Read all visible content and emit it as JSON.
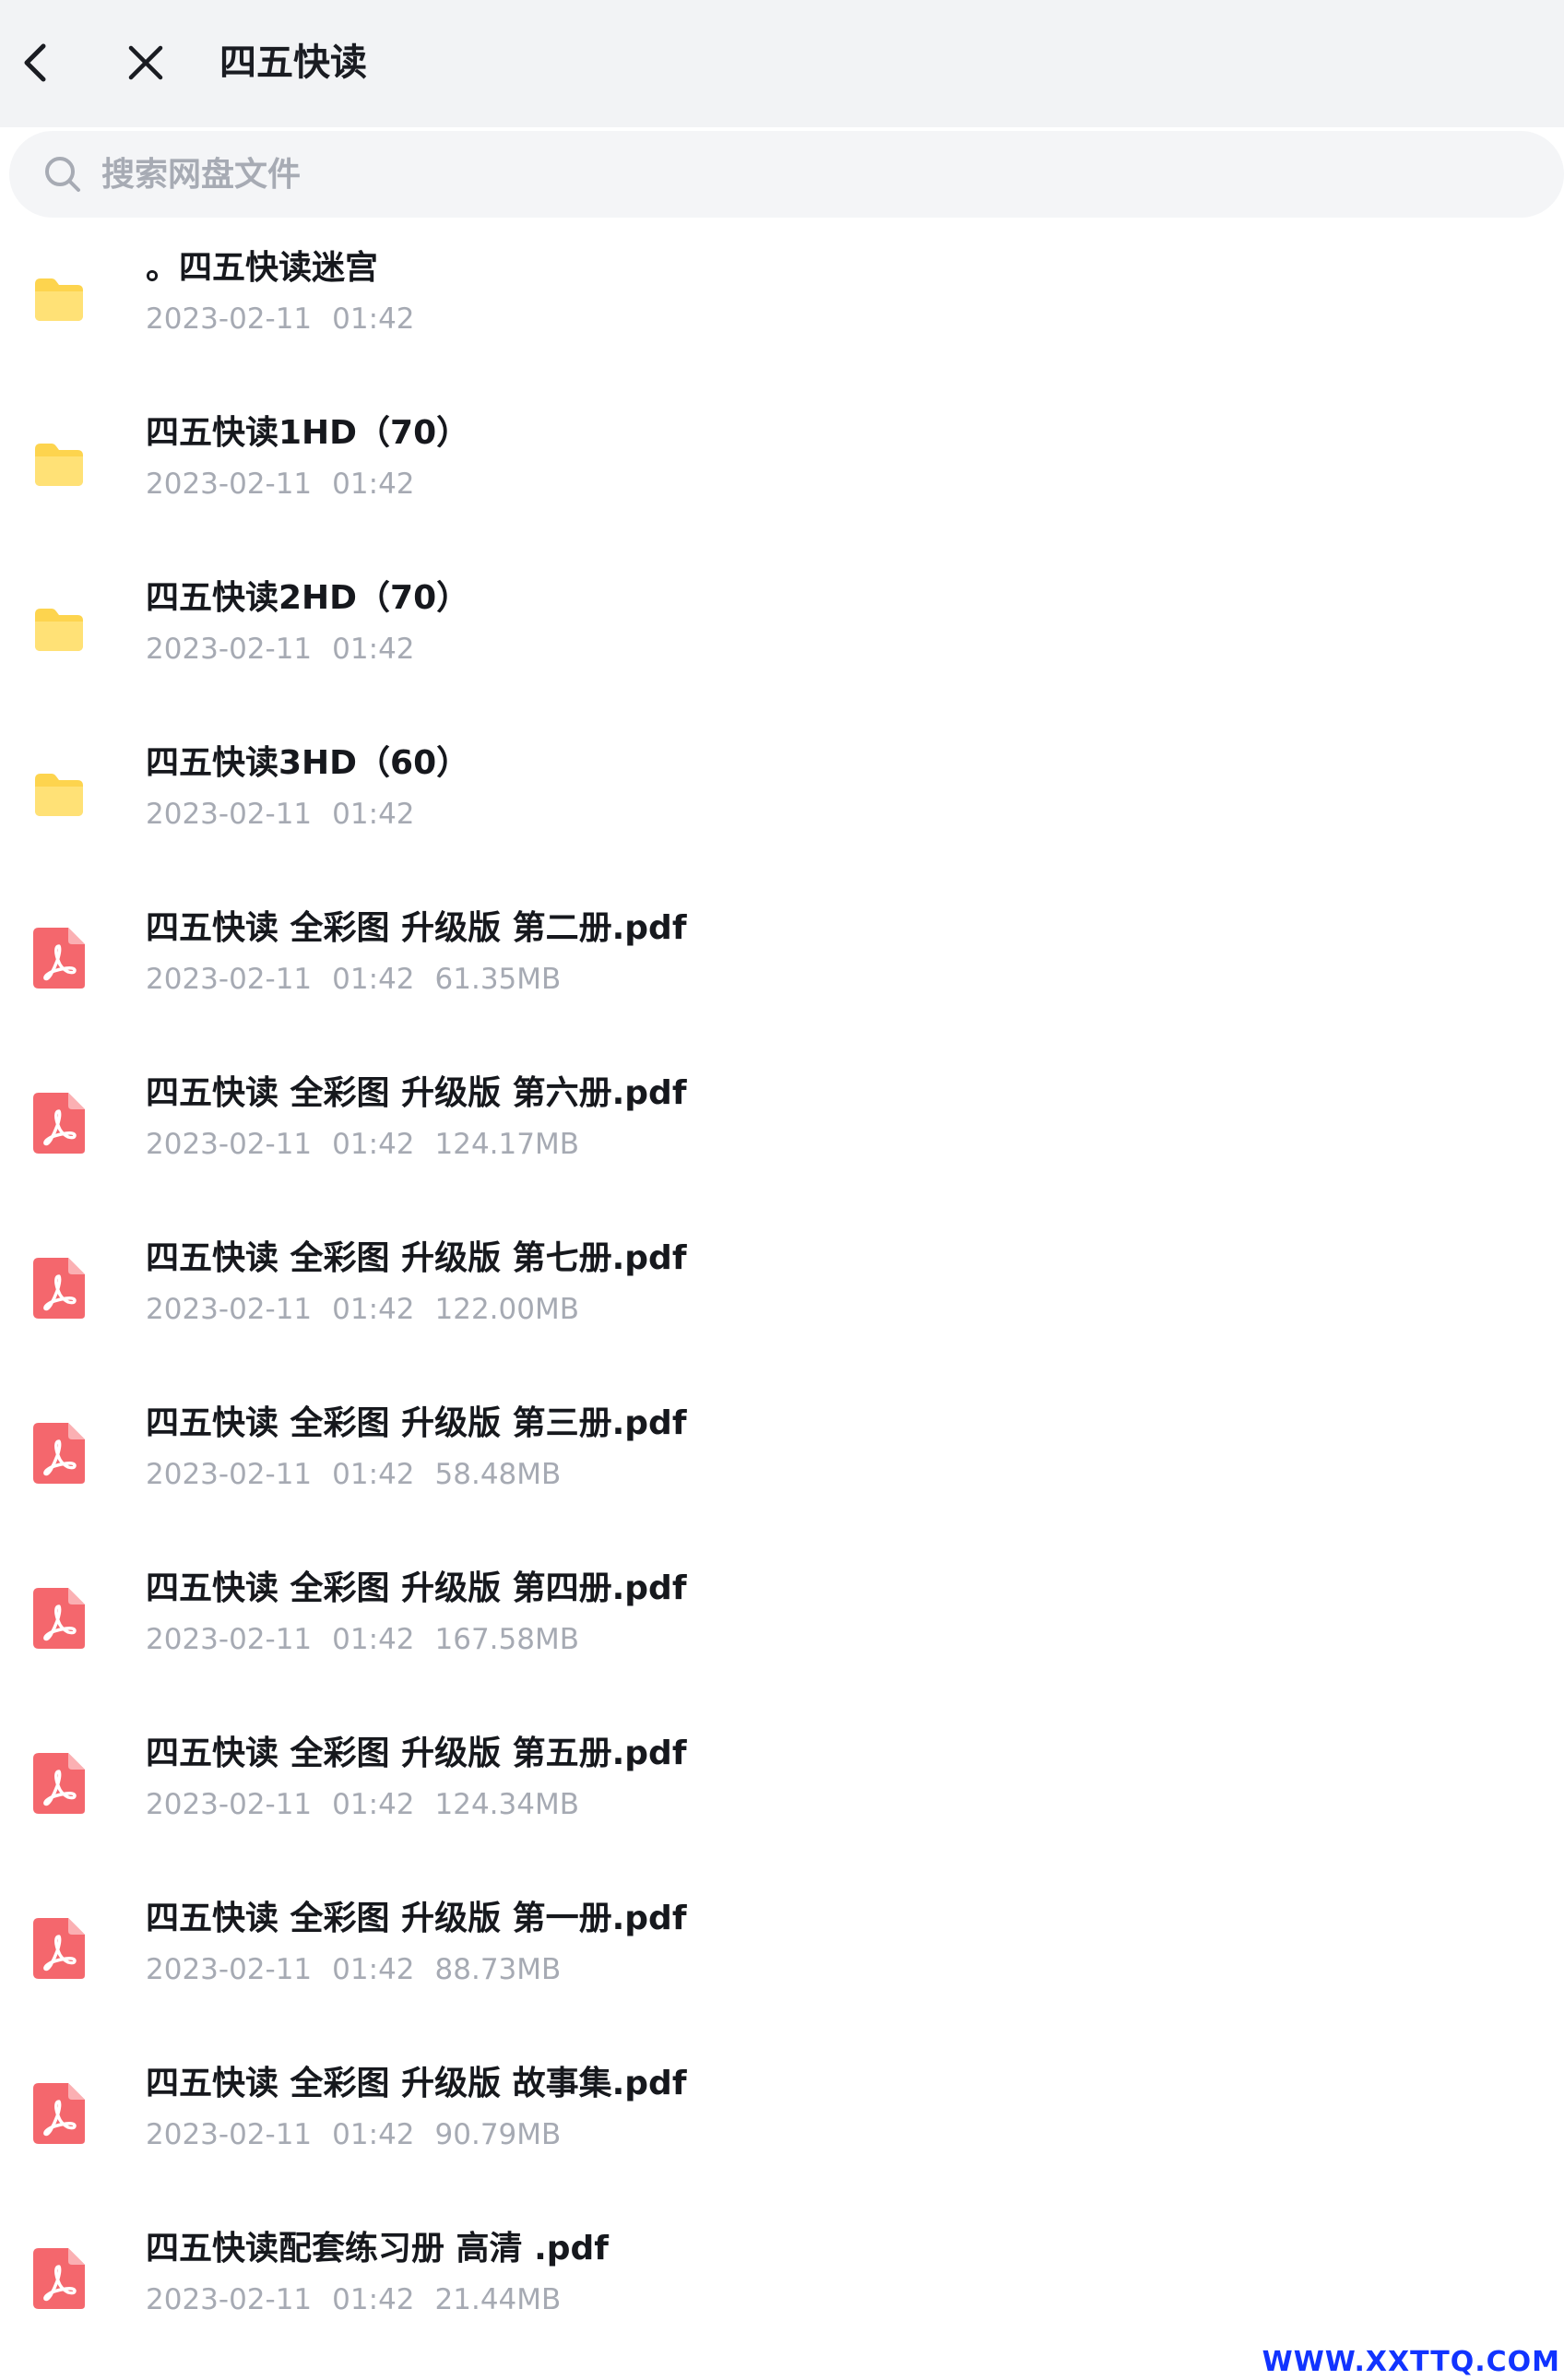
{
  "header": {
    "title": "四五快读"
  },
  "search": {
    "placeholder": "搜索网盘文件",
    "value": ""
  },
  "files": [
    {
      "type": "folder",
      "name": "。四五快读迷宫",
      "date": "2023-02-11",
      "time": "01:42",
      "size": ""
    },
    {
      "type": "folder",
      "name": "四五快读1HD（70）",
      "date": "2023-02-11",
      "time": "01:42",
      "size": ""
    },
    {
      "type": "folder",
      "name": "四五快读2HD（70）",
      "date": "2023-02-11",
      "time": "01:42",
      "size": ""
    },
    {
      "type": "folder",
      "name": "四五快读3HD（60）",
      "date": "2023-02-11",
      "time": "01:42",
      "size": ""
    },
    {
      "type": "pdf",
      "name": "四五快读 全彩图 升级版 第二册.pdf",
      "date": "2023-02-11",
      "time": "01:42",
      "size": "61.35MB"
    },
    {
      "type": "pdf",
      "name": "四五快读 全彩图 升级版 第六册.pdf",
      "date": "2023-02-11",
      "time": "01:42",
      "size": "124.17MB"
    },
    {
      "type": "pdf",
      "name": "四五快读 全彩图 升级版 第七册.pdf",
      "date": "2023-02-11",
      "time": "01:42",
      "size": "122.00MB"
    },
    {
      "type": "pdf",
      "name": "四五快读 全彩图 升级版 第三册.pdf",
      "date": "2023-02-11",
      "time": "01:42",
      "size": "58.48MB"
    },
    {
      "type": "pdf",
      "name": "四五快读 全彩图 升级版 第四册.pdf",
      "date": "2023-02-11",
      "time": "01:42",
      "size": "167.58MB"
    },
    {
      "type": "pdf",
      "name": "四五快读 全彩图 升级版 第五册.pdf",
      "date": "2023-02-11",
      "time": "01:42",
      "size": "124.34MB"
    },
    {
      "type": "pdf",
      "name": "四五快读 全彩图 升级版 第一册.pdf",
      "date": "2023-02-11",
      "time": "01:42",
      "size": "88.73MB"
    },
    {
      "type": "pdf",
      "name": "四五快读 全彩图 升级版 故事集.pdf",
      "date": "2023-02-11",
      "time": "01:42",
      "size": "90.79MB"
    },
    {
      "type": "pdf",
      "name": "四五快读配套练习册 高清 .pdf",
      "date": "2023-02-11",
      "time": "01:42",
      "size": "21.44MB"
    }
  ],
  "icons": {
    "back": "chevron-left-icon",
    "close": "close-icon",
    "search": "search-icon",
    "folder": "folder-icon",
    "pdf": "pdf-icon"
  },
  "colors": {
    "folder": "#fdd44e",
    "pdf": "#f4676d",
    "header_bg": "#f2f3f5",
    "meta_text": "#a6aab3",
    "watermark": "#1133ff"
  },
  "watermark": "WWW.XXTTQ.COM"
}
